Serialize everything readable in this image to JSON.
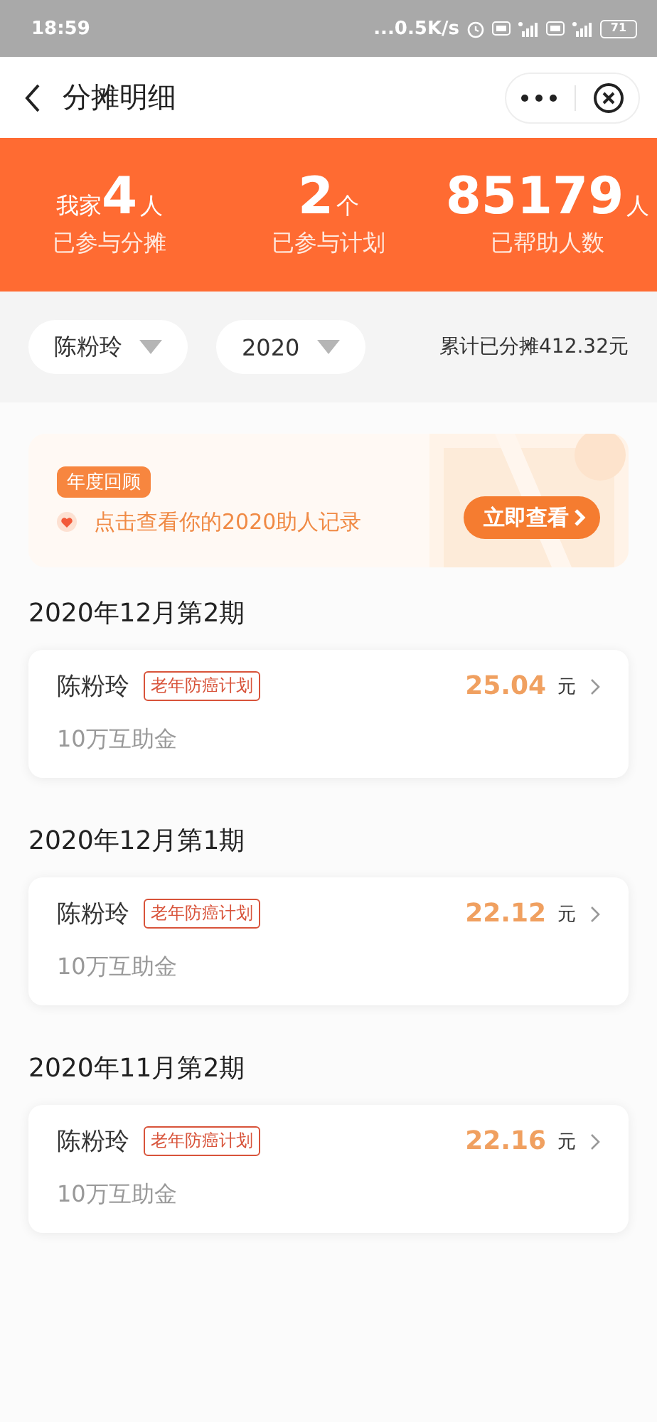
{
  "status_bar": {
    "time": "18:59",
    "network_speed": "...0.5K/s",
    "battery": "71"
  },
  "header": {
    "title": "分摊明细"
  },
  "stats": [
    {
      "prefix": "我家",
      "value": "4",
      "unit": "人",
      "label": "已参与分摊"
    },
    {
      "value": "2",
      "unit": "个",
      "label": "已参与计划"
    },
    {
      "value": "85179",
      "unit": "人",
      "label": "已帮助人数"
    }
  ],
  "filters": {
    "dropdowns": [
      {
        "label": "陈粉玲"
      },
      {
        "label": "2020"
      }
    ],
    "total": "累计已分摊412.32元"
  },
  "review": {
    "badge": "年度回顾",
    "text": "点击查看你的2020助人记录",
    "button": "立即查看"
  },
  "periods": [
    {
      "title": "2020年12月第2期",
      "items": [
        {
          "name": "陈粉玲",
          "tag": "老年防癌计划",
          "amount": "25.04",
          "unit": "元",
          "subtitle": "10万互助金"
        }
      ]
    },
    {
      "title": "2020年12月第1期",
      "items": [
        {
          "name": "陈粉玲",
          "tag": "老年防癌计划",
          "amount": "22.12",
          "unit": "元",
          "subtitle": "10万互助金"
        }
      ]
    },
    {
      "title": "2020年11月第2期",
      "items": [
        {
          "name": "陈粉玲",
          "tag": "老年防癌计划",
          "amount": "22.16",
          "unit": "元",
          "subtitle": "10万互助金"
        }
      ]
    }
  ]
}
